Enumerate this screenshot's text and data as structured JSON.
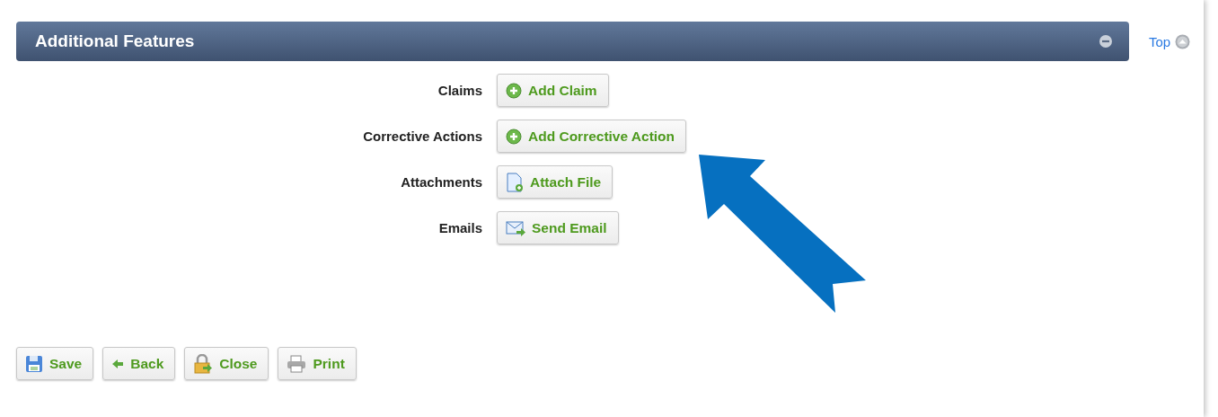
{
  "panel": {
    "title": "Additional Features",
    "expanded": true
  },
  "top_link": {
    "label": "Top"
  },
  "features": [
    {
      "label": "Claims",
      "button": {
        "label": "Add Claim",
        "kind": "add"
      }
    },
    {
      "label": "Corrective Actions",
      "button": {
        "label": "Add Corrective Action",
        "kind": "add"
      }
    },
    {
      "label": "Attachments",
      "button": {
        "label": "Attach File",
        "kind": "file"
      }
    },
    {
      "label": "Emails",
      "button": {
        "label": "Send Email",
        "kind": "email"
      }
    }
  ],
  "actions": [
    {
      "label": "Save",
      "kind": "save"
    },
    {
      "label": "Back",
      "kind": "back"
    },
    {
      "label": "Close",
      "kind": "lock"
    },
    {
      "label": "Print",
      "kind": "print"
    }
  ]
}
